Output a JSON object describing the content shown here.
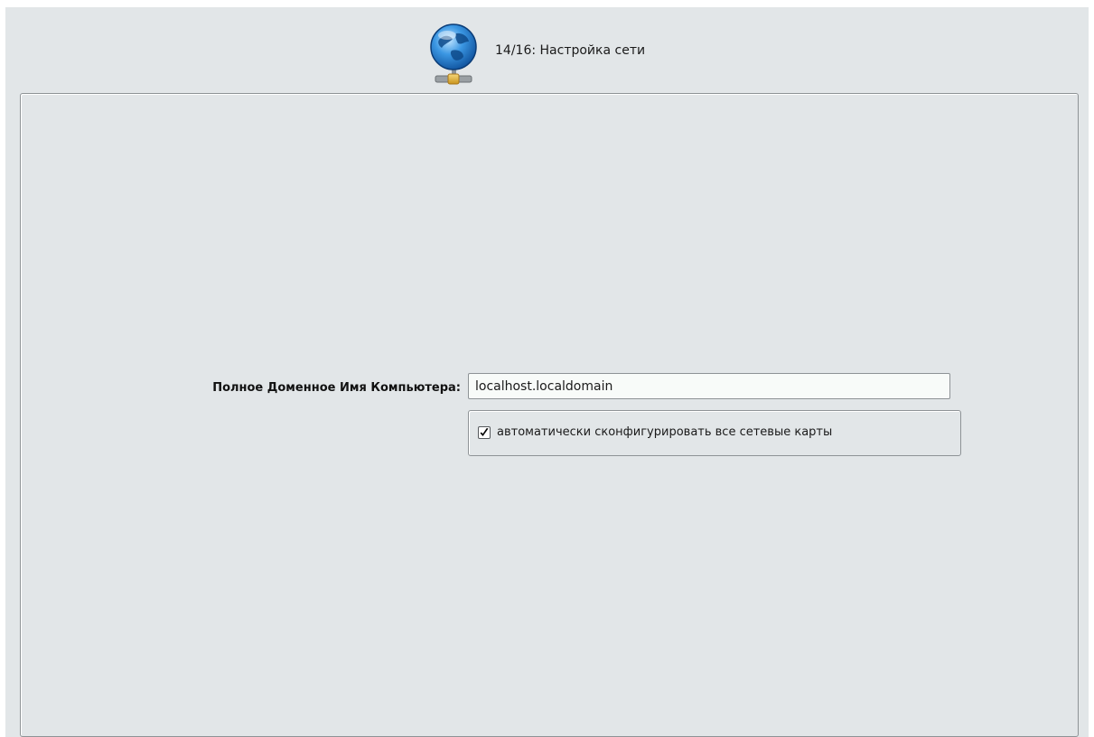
{
  "header": {
    "step_title": "14/16: Настройка сети",
    "icon": "network-globe-icon"
  },
  "form": {
    "fqdn_label": "Полное Доменное Имя Компьютера:",
    "fqdn_value": "localhost.localdomain",
    "auto_config_label": "автоматически сконфигурировать все сетевые карты",
    "auto_config_checked": true
  },
  "colors": {
    "background": "#e2e6e8",
    "border": "#8e9396",
    "input_background": "#f8fbf9",
    "globe_blue": "#2f86d8"
  }
}
